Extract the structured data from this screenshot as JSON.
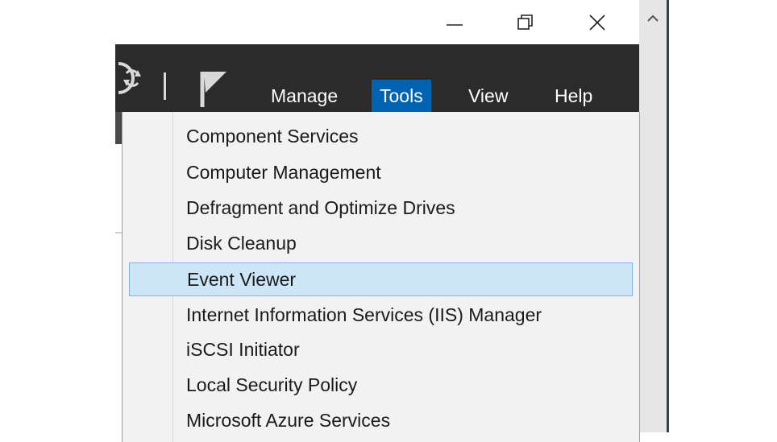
{
  "window_controls": {
    "minimize_icon": "minimize-icon",
    "restore_icon": "restore-icon",
    "close_icon": "close-icon"
  },
  "toolbar": {
    "refresh_icon": "refresh-icon",
    "flag_icon": "notification-flag-icon",
    "menu": [
      {
        "label": "Manage"
      },
      {
        "label": "Tools",
        "active": true
      },
      {
        "label": "View"
      },
      {
        "label": "Help"
      }
    ]
  },
  "tools_menu": {
    "items": [
      {
        "label": "Component Services"
      },
      {
        "label": "Computer Management"
      },
      {
        "label": "Defragment and Optimize Drives"
      },
      {
        "label": "Disk Cleanup"
      },
      {
        "label": "Event Viewer",
        "highlighted": true
      },
      {
        "label": "Internet Information Services (IIS) Manager"
      },
      {
        "label": "iSCSI Initiator"
      },
      {
        "label": "Local Security Policy"
      },
      {
        "label": "Microsoft Azure Services"
      }
    ]
  },
  "colors": {
    "toolbar_bg": "#2b2b2b",
    "active_menu_bg": "#0063b1",
    "highlight_bg": "#cde6f7",
    "highlight_border": "#7eb4ea",
    "menu_bg": "#f2f2f2"
  }
}
